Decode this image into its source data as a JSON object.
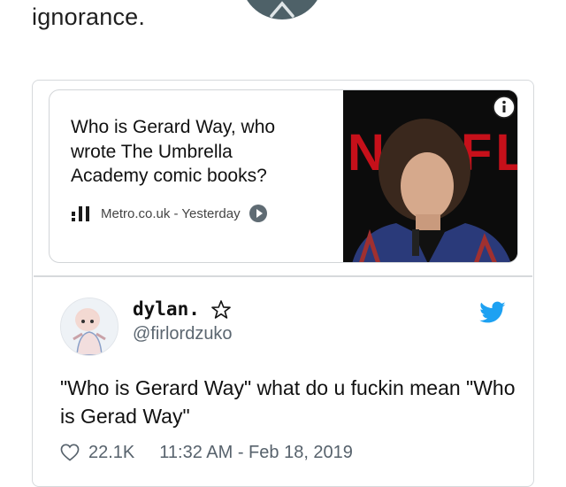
{
  "page": {
    "top_text": "ignorance."
  },
  "link_card": {
    "title": "Who is Gerard Way, who wrote The Umbrella Academy comic books?",
    "source": "Metro.co.uk - Yesterday",
    "thumbnail_text": "NETFLIX",
    "icons": [
      "metro-logo-icon",
      "play-icon",
      "info-icon"
    ]
  },
  "tweet": {
    "display_name": "dylan.",
    "handle": "@firlordzuko",
    "text": "\"Who is Gerard Way\" what do u fuckin mean \"Who is Gerad Way\"",
    "likes": "22.1K",
    "timestamp": "11:32 AM - Feb 18, 2019",
    "icons": [
      "star-icon",
      "twitter-bird-icon",
      "heart-icon"
    ]
  },
  "colors": {
    "twitter_blue": "#1da1f2",
    "netflix_red": "#c6101a",
    "fab_bg": "#4e6168"
  }
}
